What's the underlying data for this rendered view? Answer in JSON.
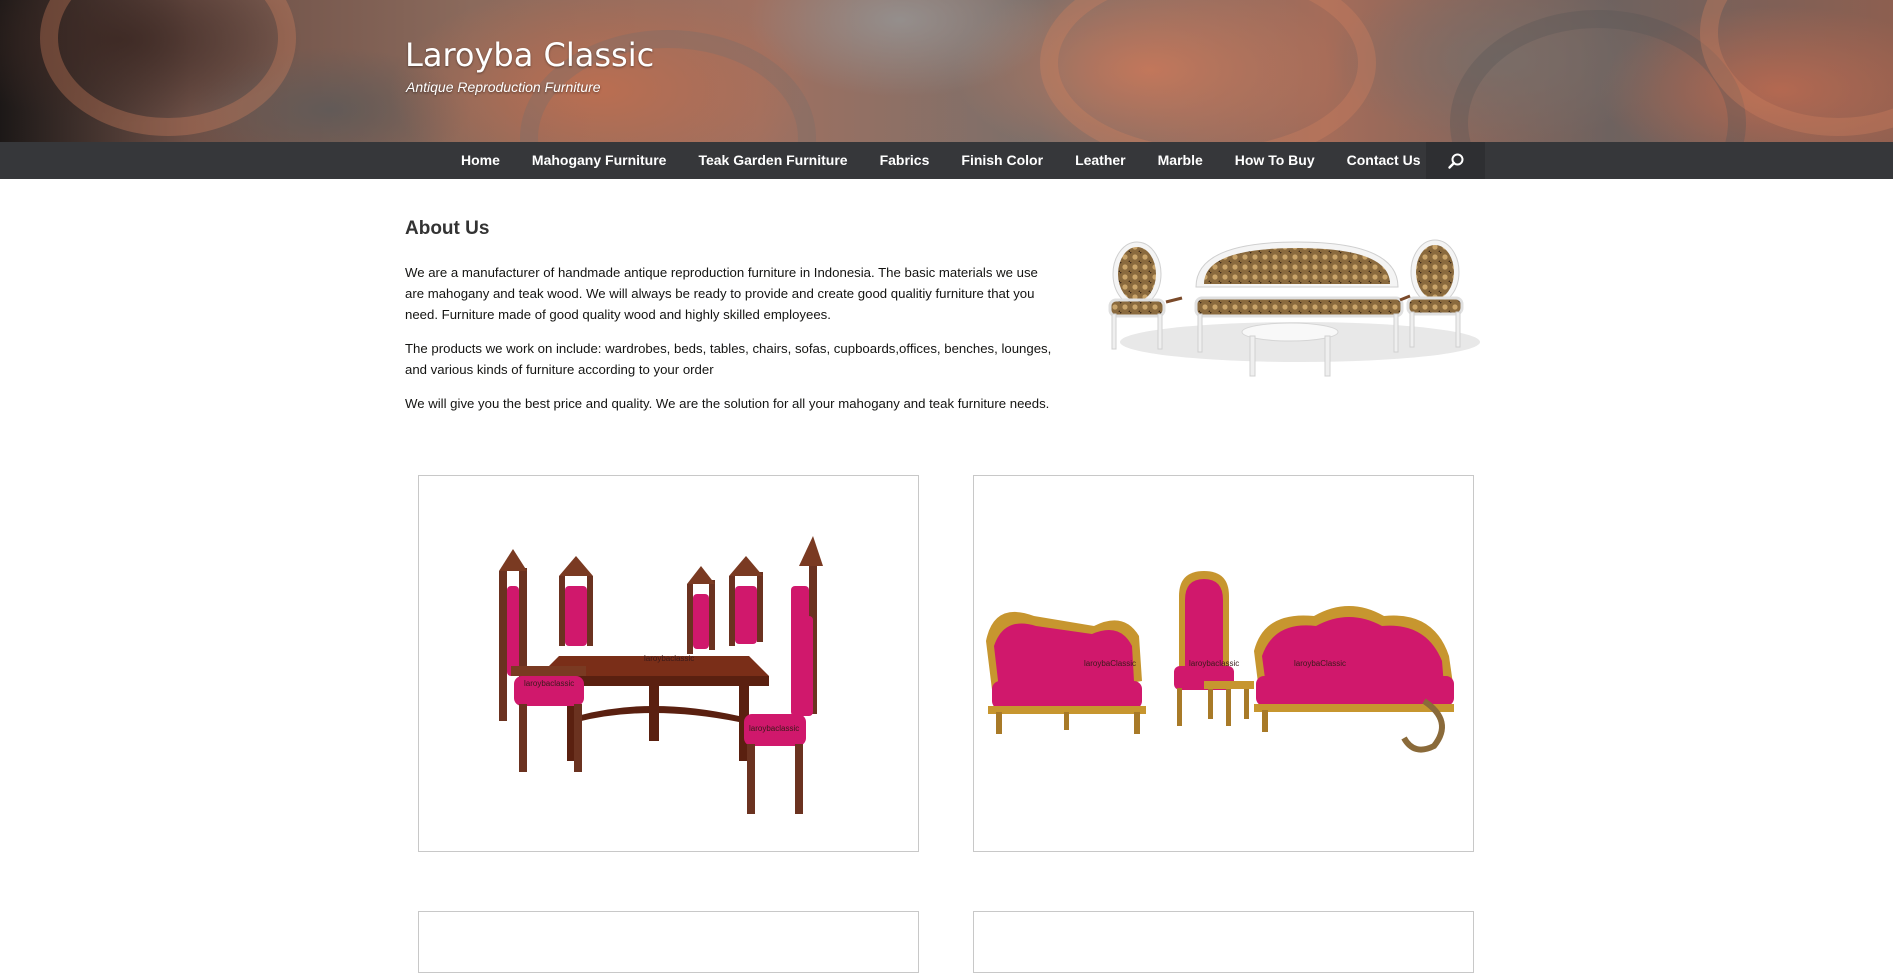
{
  "site": {
    "title": "Laroyba Classic",
    "description": "Antique Reproduction Furniture"
  },
  "nav": {
    "items": [
      {
        "label": "Home"
      },
      {
        "label": "Mahogany Furniture"
      },
      {
        "label": "Teak Garden Furniture"
      },
      {
        "label": "Fabrics"
      },
      {
        "label": "Finish Color"
      },
      {
        "label": "Leather"
      },
      {
        "label": "Marble"
      },
      {
        "label": "How To Buy"
      },
      {
        "label": "Contact Us"
      }
    ],
    "search_icon": "search-icon"
  },
  "about": {
    "title": "About Us",
    "paragraphs": [
      "We are a manufacturer of handmade antique reproduction furniture in Indonesia. The basic materials we use are mahogany and teak wood. We will always be ready to provide and create good qualitiy furniture that you need. Furniture made of good quality wood and highly skilled employees.",
      "The products we work on include: wardrobes, beds, tables, chairs, sofas, cupboards,offices, benches, lounges, and various kinds of furniture according to your order",
      "We will give you the best price and quality. We are the solution for all your mahogany and teak furniture needs."
    ]
  },
  "products": {
    "watermark": "laroybaclassic",
    "watermark_alt": "laroybaClassic"
  },
  "colors": {
    "nav_bg": "#36373a",
    "search_bg": "#2e2f32",
    "upholstery_pink": "#d0186c",
    "wood_brown": "#6b3220",
    "frame_white": "#f2f2f2",
    "fabric_gold": "#9a7a4a"
  }
}
